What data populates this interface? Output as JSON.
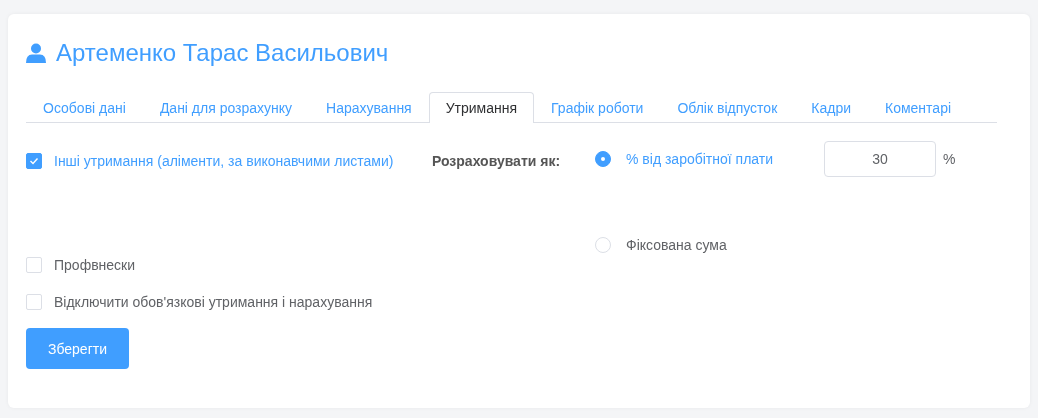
{
  "title": "Артеменко Тарас Васильович",
  "tabs": [
    {
      "label": "Особові дані",
      "selected": false
    },
    {
      "label": "Дані для розрахунку",
      "selected": false
    },
    {
      "label": "Нарахування",
      "selected": false
    },
    {
      "label": "Утримання",
      "selected": true
    },
    {
      "label": "Графік роботи",
      "selected": false
    },
    {
      "label": "Облік відпусток",
      "selected": false
    },
    {
      "label": "Кадри",
      "selected": false
    },
    {
      "label": "Коментарі",
      "selected": false
    }
  ],
  "other_deductions": {
    "label": "Інші утримання (аліменти, за виконавчими листами)",
    "checked": true
  },
  "calculate_as": {
    "label": "Розраховувати як:",
    "options": [
      {
        "label": "% від заробітної плати",
        "selected": true,
        "value": "30",
        "unit": "%"
      },
      {
        "label": "Фіксована сума",
        "selected": false
      }
    ]
  },
  "checkboxes": [
    {
      "label": "Профвнески",
      "checked": false
    },
    {
      "label": "Відключити обов'язкові утримання і нарахування",
      "checked": false
    }
  ],
  "save_button": "Зберегти"
}
